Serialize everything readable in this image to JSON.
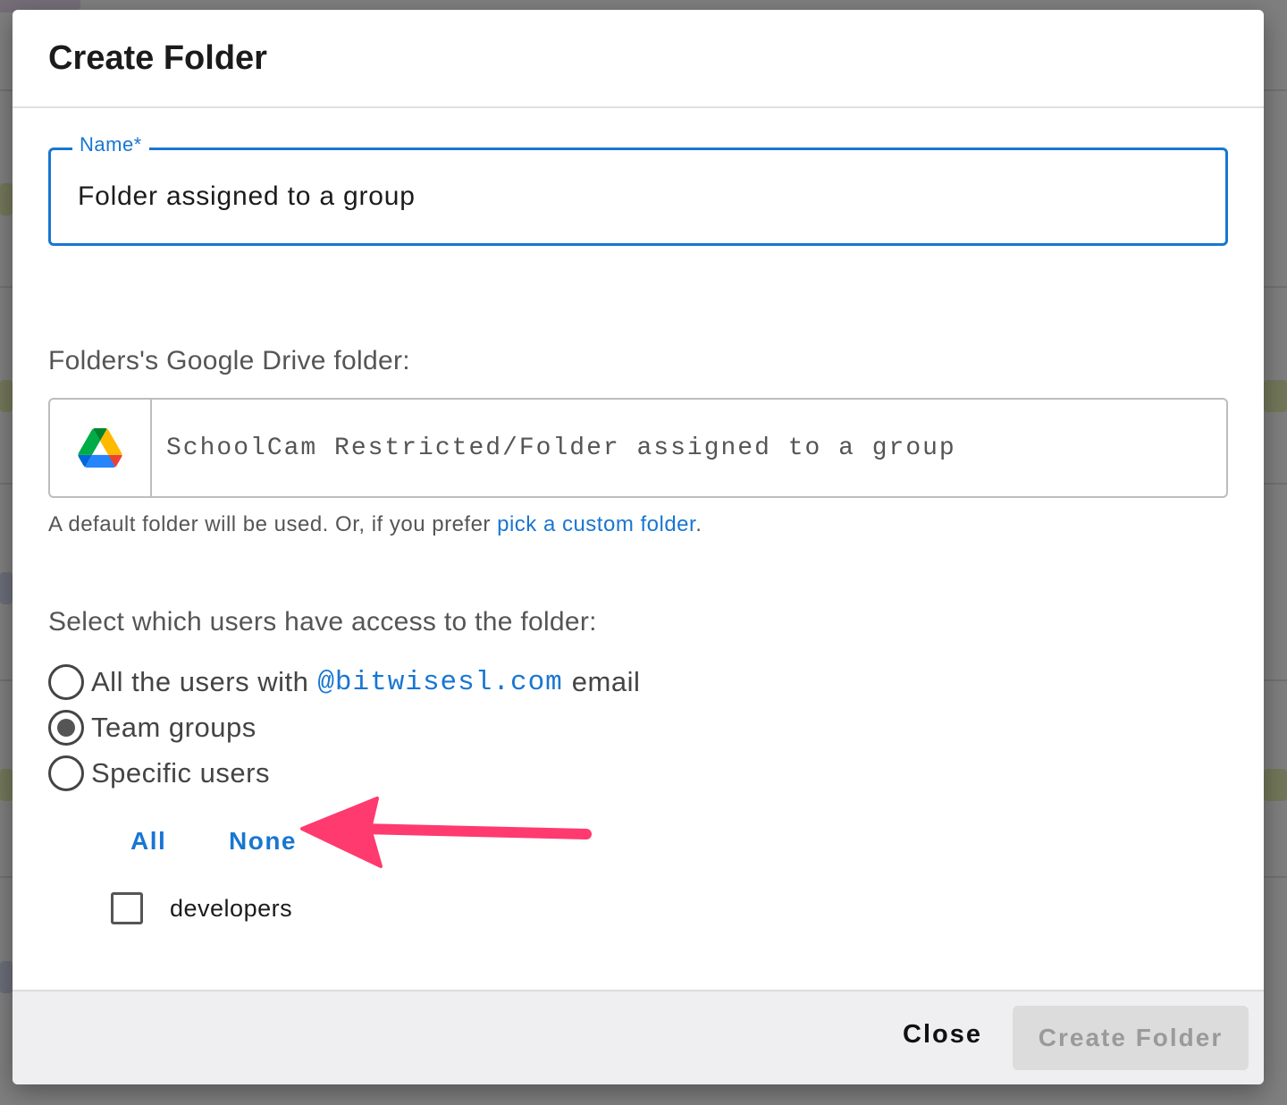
{
  "dialog": {
    "title": "Create Folder",
    "name_field": {
      "label": "Name*",
      "value": "Folder assigned to a group"
    },
    "drive_section": {
      "label": "Folders's Google Drive folder:",
      "icon": "google-drive-icon",
      "path": "SchoolCam Restricted/Folder assigned to a group",
      "helper_prefix": "A default folder will be used. Or, if you prefer ",
      "helper_link": "pick a custom folder",
      "helper_suffix": "."
    },
    "access_section": {
      "label": "Select which users have access to the folder:",
      "option_all_prefix": "All the users with",
      "option_all_domain": "@bitwisesl.com",
      "option_all_suffix": "email",
      "option_team": "Team groups",
      "option_specific": "Specific users",
      "selected": "Team groups",
      "select_all": "All",
      "select_none": "None",
      "groups": [
        {
          "label": "developers",
          "checked": false
        }
      ]
    },
    "footer": {
      "close_label": "Close",
      "create_label": "Create Folder"
    }
  },
  "colors": {
    "accent": "#1976d2",
    "annotation_arrow": "#ff3a6e",
    "disabled_button_bg": "#dcdcdc",
    "disabled_button_text": "#9a9a9a"
  }
}
